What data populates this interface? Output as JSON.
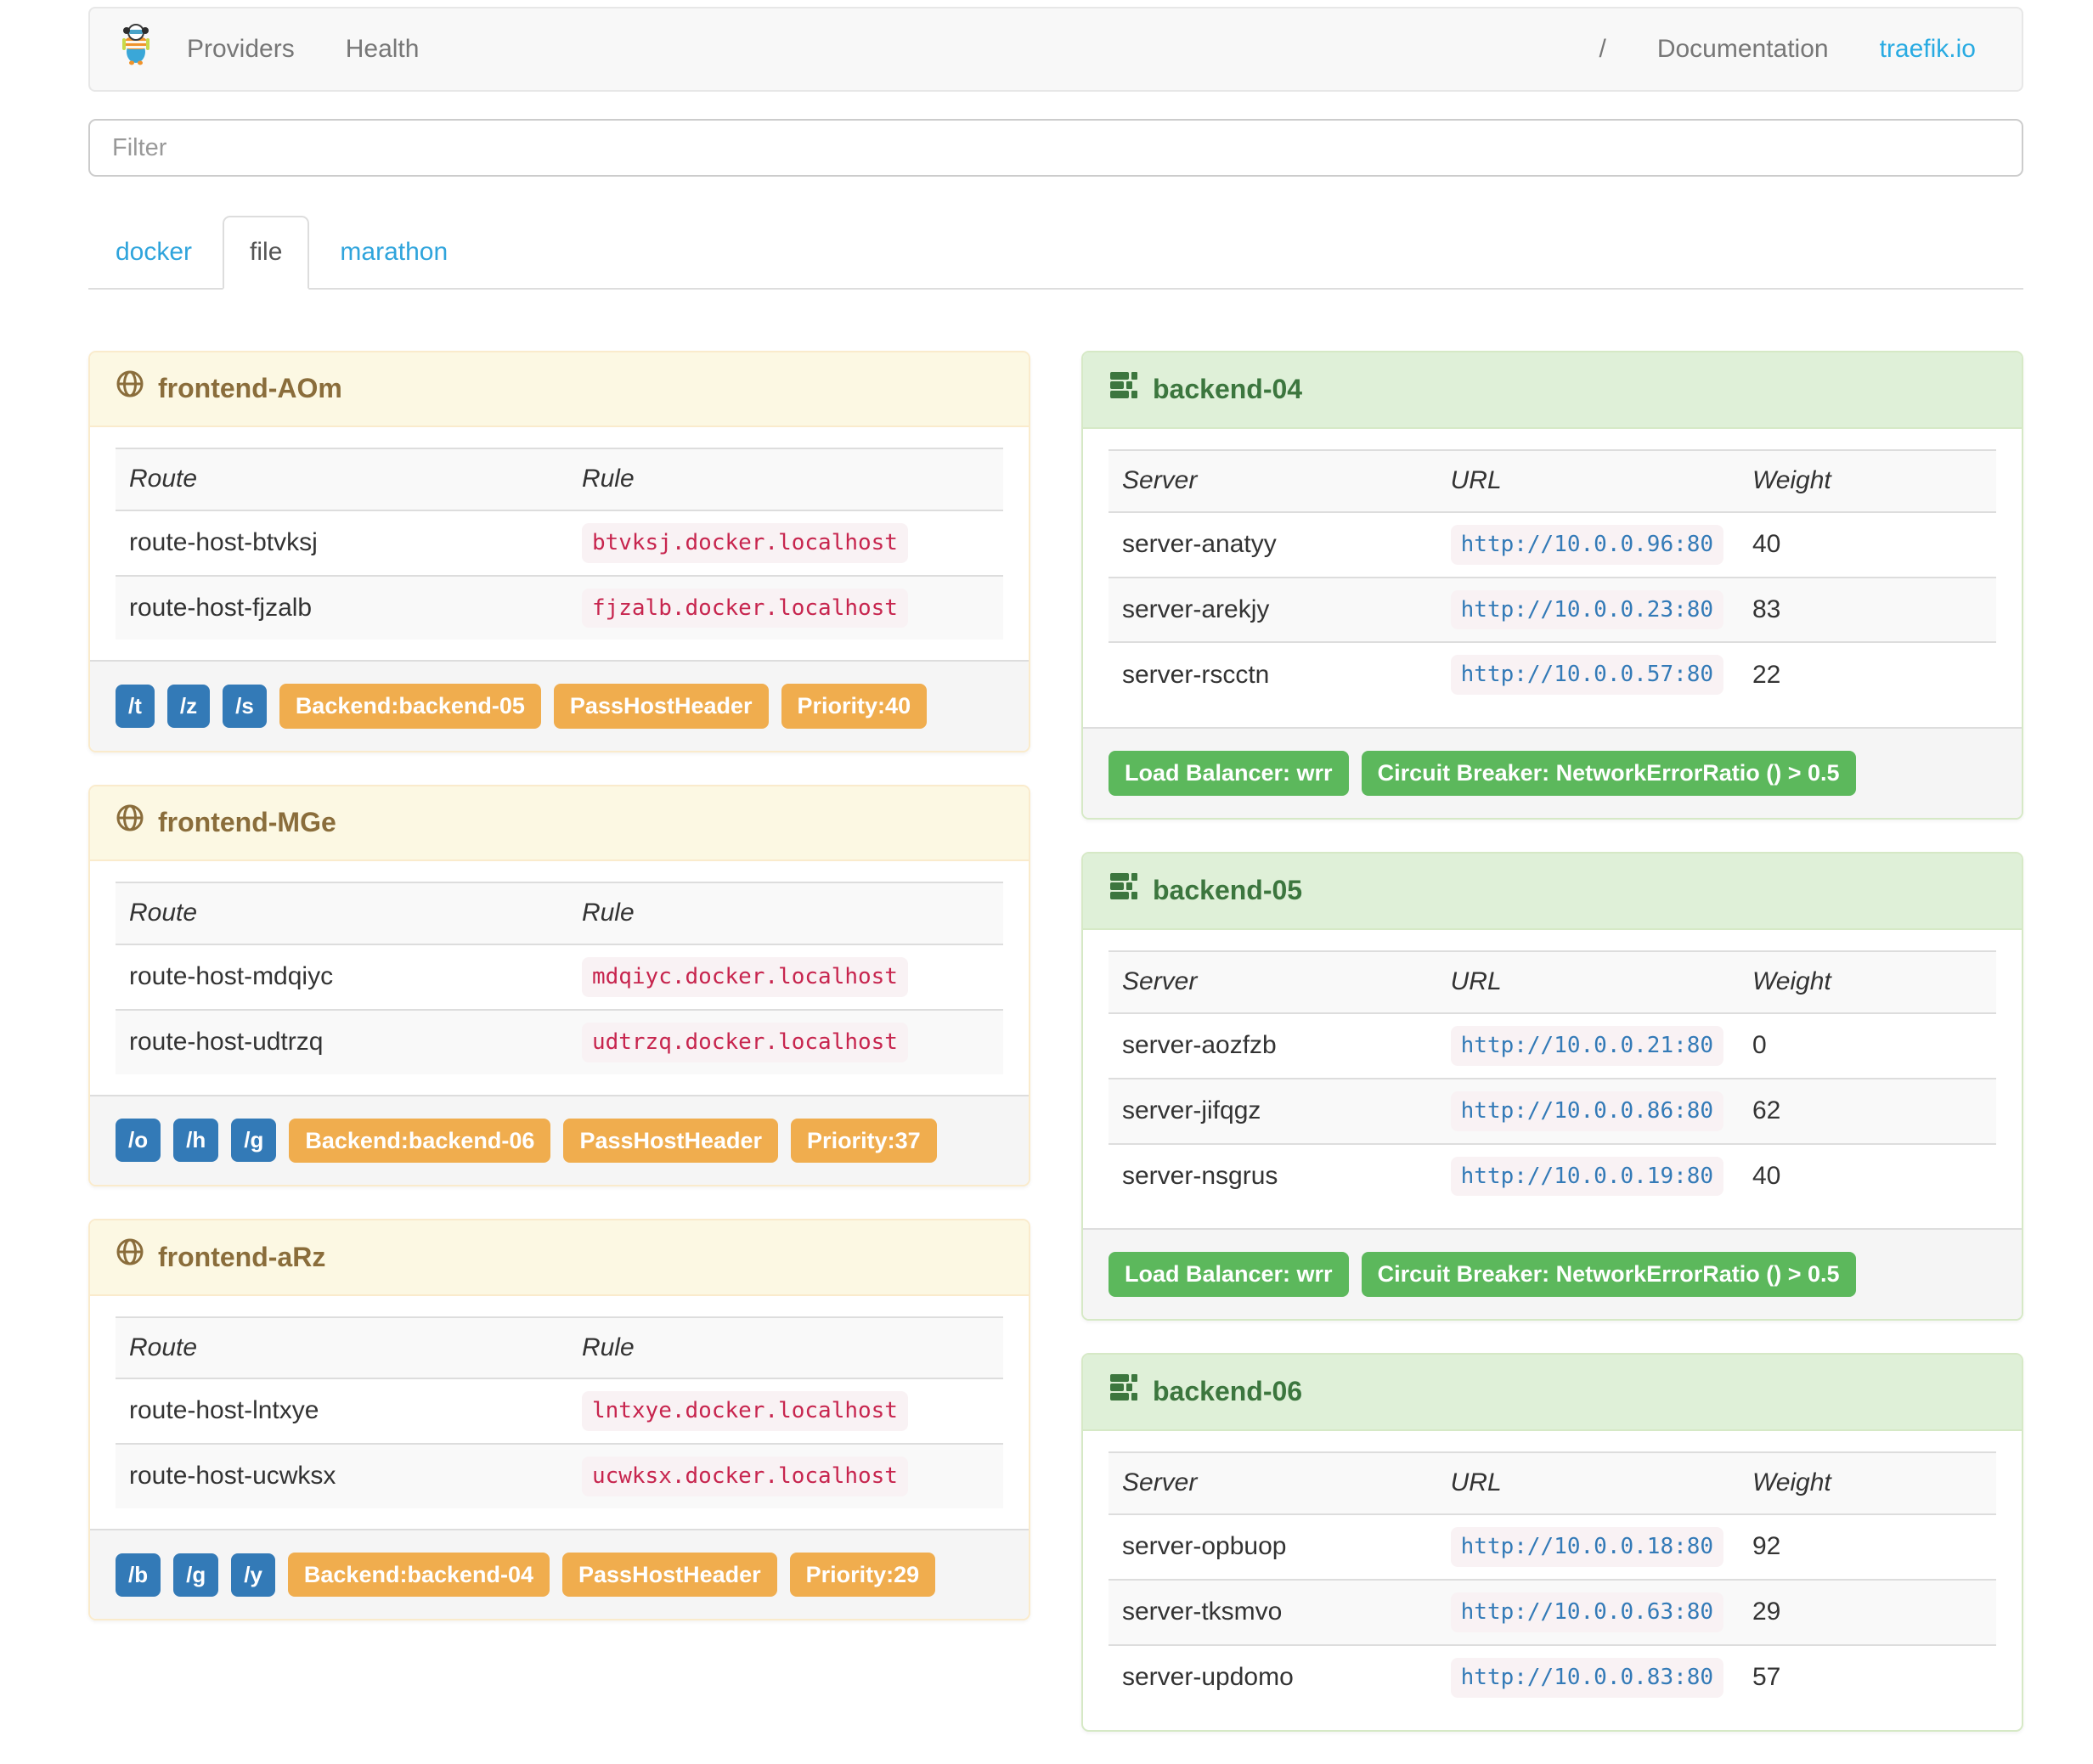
{
  "navbar": {
    "links_left": [
      "Providers",
      "Health"
    ],
    "separator": "/",
    "links_right": [
      "Documentation",
      "traefik.io"
    ]
  },
  "filter": {
    "placeholder": "Filter"
  },
  "tabs": {
    "items": [
      "docker",
      "file",
      "marathon"
    ],
    "active": "file"
  },
  "table_headers": {
    "route": "Route",
    "rule": "Rule",
    "server": "Server",
    "url": "URL",
    "weight": "Weight"
  },
  "frontends": [
    {
      "name": "frontend-AOm",
      "routes": [
        {
          "route": "route-host-btvksj",
          "rule": "btvksj.docker.localhost"
        },
        {
          "route": "route-host-fjzalb",
          "rule": "fjzalb.docker.localhost"
        }
      ],
      "entry_points": [
        "/t",
        "/z",
        "/s"
      ],
      "backend": "Backend:backend-05",
      "pass_host_header": "PassHostHeader",
      "priority": "Priority:40"
    },
    {
      "name": "frontend-MGe",
      "routes": [
        {
          "route": "route-host-mdqiyc",
          "rule": "mdqiyc.docker.localhost"
        },
        {
          "route": "route-host-udtrzq",
          "rule": "udtrzq.docker.localhost"
        }
      ],
      "entry_points": [
        "/o",
        "/h",
        "/g"
      ],
      "backend": "Backend:backend-06",
      "pass_host_header": "PassHostHeader",
      "priority": "Priority:37"
    },
    {
      "name": "frontend-aRz",
      "routes": [
        {
          "route": "route-host-lntxye",
          "rule": "lntxye.docker.localhost"
        },
        {
          "route": "route-host-ucwksx",
          "rule": "ucwksx.docker.localhost"
        }
      ],
      "entry_points": [
        "/b",
        "/g",
        "/y"
      ],
      "backend": "Backend:backend-04",
      "pass_host_header": "PassHostHeader",
      "priority": "Priority:29"
    }
  ],
  "backends": [
    {
      "name": "backend-04",
      "servers": [
        {
          "server": "server-anatyy",
          "url": "http://10.0.0.96:80",
          "weight": "40"
        },
        {
          "server": "server-arekjy",
          "url": "http://10.0.0.23:80",
          "weight": "83"
        },
        {
          "server": "server-rscctn",
          "url": "http://10.0.0.57:80",
          "weight": "22"
        }
      ],
      "load_balancer": "Load Balancer: wrr",
      "circuit_breaker": "Circuit Breaker: NetworkErrorRatio () > 0.5"
    },
    {
      "name": "backend-05",
      "servers": [
        {
          "server": "server-aozfzb",
          "url": "http://10.0.0.21:80",
          "weight": "0"
        },
        {
          "server": "server-jifqgz",
          "url": "http://10.0.0.86:80",
          "weight": "62"
        },
        {
          "server": "server-nsgrus",
          "url": "http://10.0.0.19:80",
          "weight": "40"
        }
      ],
      "load_balancer": "Load Balancer: wrr",
      "circuit_breaker": "Circuit Breaker: NetworkErrorRatio () > 0.5"
    },
    {
      "name": "backend-06",
      "servers": [
        {
          "server": "server-opbuop",
          "url": "http://10.0.0.18:80",
          "weight": "92"
        },
        {
          "server": "server-tksmvo",
          "url": "http://10.0.0.63:80",
          "weight": "29"
        },
        {
          "server": "server-updomo",
          "url": "http://10.0.0.83:80",
          "weight": "57"
        }
      ]
    }
  ],
  "colors": {
    "link_blue": "#29abe2",
    "tab_blue": "#2fa4dc",
    "label_primary": "#337ab7",
    "label_warning": "#f0ad4e",
    "label_success": "#5cb85c",
    "frontend_heading_bg": "#fcf8e3",
    "frontend_heading_text": "#8a6d3b",
    "backend_heading_bg": "#dff0d8",
    "backend_heading_text": "#3c763e",
    "code_red": "#c7254e",
    "code_bg": "#f9f2f4",
    "url_blue": "#337ab7"
  }
}
